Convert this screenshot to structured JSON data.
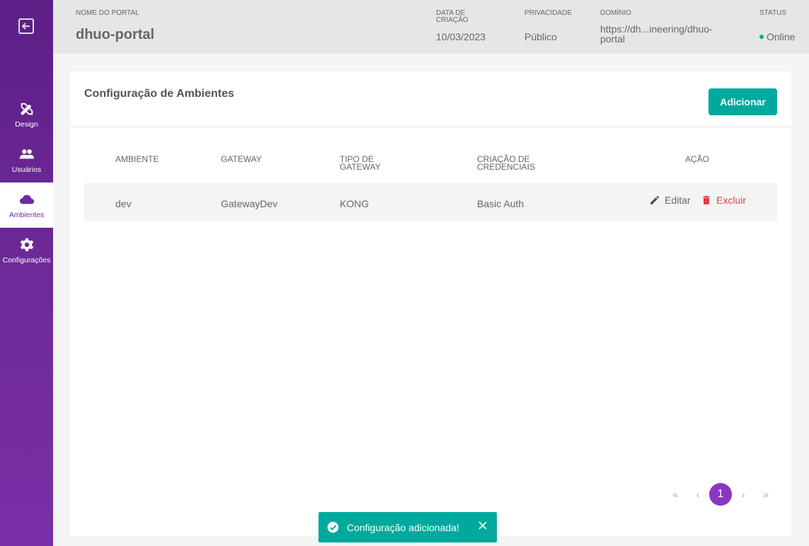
{
  "sidebar": {
    "items": [
      {
        "label": "Design",
        "icon": "design-tools-icon"
      },
      {
        "label": "Usuários",
        "icon": "users-icon"
      },
      {
        "label": "Ambientes",
        "icon": "cloud-icon",
        "active": true
      },
      {
        "label": "Configurações",
        "icon": "gear-icon"
      }
    ]
  },
  "header": {
    "name_label": "NOME DO PORTAL",
    "name": "dhuo-portal",
    "date_label_1": "DATA DE",
    "date_label_2": "CRIAÇÃO",
    "date": "10/03/2023",
    "privacy_label": "PRIVACIDADE",
    "privacy": "Público",
    "domain_label": "DOMÍNIO",
    "domain_1": "https://dh...ineering/dhuo-",
    "domain_2": "portal",
    "status_label": "STATUS",
    "status": "Online",
    "status_color": "#00a99d"
  },
  "card": {
    "title": "Configuração de Ambientes",
    "add_label": "Adicionar",
    "columns": {
      "ambiente": "AMBIENTE",
      "gateway": "GATEWAY",
      "tipo_1": "TIPO DE",
      "tipo_2": "GATEWAY",
      "cred_1": "CRIAÇÃO DE",
      "cred_2": "CREDENCIAIS",
      "acao": "AÇÃO"
    },
    "rows": [
      {
        "ambiente": "dev",
        "gateway": "GatewayDev",
        "tipo": "KONG",
        "credenciais": "Basic Auth",
        "edit": "Editar",
        "delete": "Excluir"
      }
    ]
  },
  "pagination": {
    "first": "«",
    "prev": "‹",
    "current": "1",
    "next": "›",
    "last": "»"
  },
  "toast": {
    "message": "Configuração adicionada!"
  },
  "colors": {
    "accent": "#00a99d",
    "sidebar": "#6a2c9a",
    "danger": "#e53e4a",
    "page_current": "#8a35c4"
  }
}
